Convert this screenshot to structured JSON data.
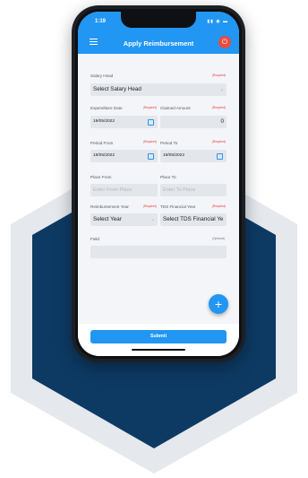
{
  "status": {
    "time": "1:19",
    "icons": "▮▮ ◉ ▬"
  },
  "appbar": {
    "title": "Apply Reimbursement",
    "menu_icon": "menu-icon",
    "power_icon": "power-icon"
  },
  "form": {
    "salary_head": {
      "label": "Salary Head",
      "required": "(Required)",
      "value": "Select Salary Head"
    },
    "expenditure_date": {
      "label": "Expenditure Date",
      "required": "(Required)",
      "value": "19/05/2022"
    },
    "claimed_amount": {
      "label": "Claimed Amount",
      "required": "(Required)",
      "value": "0"
    },
    "period_from": {
      "label": "Period From",
      "required": "(Required)",
      "value": "19/05/2022"
    },
    "period_to": {
      "label": "Period To",
      "required": "(Required)",
      "value": "19/05/2022"
    },
    "place_from": {
      "label": "Place From",
      "placeholder": "Enter From Place"
    },
    "place_to": {
      "label": "Place To",
      "placeholder": "Enter To Place"
    },
    "reimbursement_year": {
      "label": "Reimbursement Year",
      "required": "(Required)",
      "value": "Select Year"
    },
    "tds_financial_year": {
      "label": "TDS Financial Year",
      "required": "(Required)",
      "value": "Select TDS Financial Ye"
    },
    "field": {
      "label": "Field",
      "optional": "(Optional)",
      "value": ""
    }
  },
  "fab": {
    "label": "+"
  },
  "footer": {
    "submit_label": "Submit"
  },
  "colors": {
    "primary": "#2196f3",
    "required": "#e53935",
    "power": "#e74c3c",
    "hex_dark": "#0d3a63",
    "hex_light": "#e5e8ed"
  }
}
